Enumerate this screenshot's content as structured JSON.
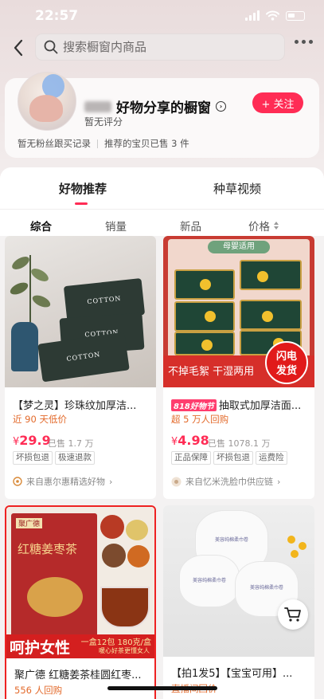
{
  "status_bar": {
    "time": "22:57"
  },
  "search": {
    "placeholder": "搜索橱窗内商品"
  },
  "store": {
    "name": "好物分享的橱窗",
    "rating": "暂无评分",
    "follow_label": "+ 关注",
    "stat_fans": "暂无粉丝跟买记录",
    "stat_sold": "推荐的宝贝已售 3 件"
  },
  "tabs": [
    {
      "label": "好物推荐",
      "active": true
    },
    {
      "label": "种草视频",
      "active": false
    }
  ],
  "sort_options": [
    {
      "label": "综合",
      "active": true
    },
    {
      "label": "销量",
      "active": false
    },
    {
      "label": "新品",
      "active": false
    },
    {
      "label": "价格",
      "active": false
    }
  ],
  "products": [
    {
      "title": "【梦之灵】珍珠纹加厚洁...",
      "subtitle": "近 90 天低价",
      "price_symbol": "¥",
      "price": "29.9",
      "sold": "已售 1.7 万",
      "tags": [
        "坏损包退",
        "极速退款"
      ],
      "source": "来自惠尔惠精选好物",
      "image_text": [
        "COTTON",
        "COTTON",
        "COTTON"
      ]
    },
    {
      "festival": "818好物节",
      "title": "抽取式加厚洁面...",
      "subtitle": "超 5 万人回购",
      "price_symbol": "¥",
      "price": "4.98",
      "sold": "已售 1078.1 万",
      "tags": [
        "正品保障",
        "坏损包退",
        "运费险"
      ],
      "source": "来自忆米洗脸巾供应链",
      "image_text": {
        "header": "母婴适用",
        "banner": "不掉毛絮 干湿两用",
        "badge_line1": "闪电",
        "badge_line2": "发货"
      }
    },
    {
      "title": "聚广德  红糖姜茶桂圆红枣...",
      "subtitle": "556 人回购",
      "image_text": {
        "brand": "聚广德",
        "vertical_title": "红糖姜枣茶",
        "promo_big": "呵护女性",
        "promo_small": "一盒12包 180克/盒",
        "promo_sub": "暖心好茶更懂女人"
      }
    },
    {
      "title": "【拍1发5】【宝宝可用】...",
      "subtitle": "直播间回价",
      "image_text": [
        "美容纯棉柔巾卷",
        "美容纯棉柔巾卷",
        "美容纯棉柔巾卷"
      ]
    }
  ]
}
